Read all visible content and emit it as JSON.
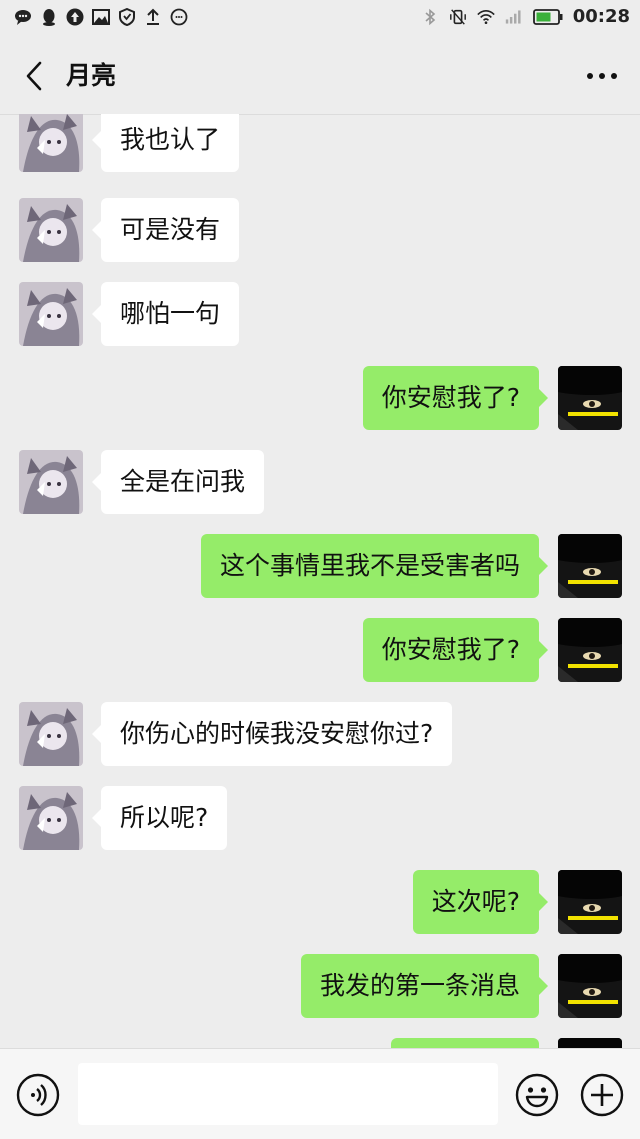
{
  "status_bar": {
    "time": "00:28",
    "left_icons": [
      "message-icon",
      "qq-icon",
      "upload-circle-icon",
      "image-icon",
      "shield-icon",
      "upload-icon",
      "smiley-icon"
    ],
    "right_icons": [
      "bluetooth-icon",
      "vibrate-icon",
      "wifi-icon",
      "signal-icon",
      "battery-icon"
    ]
  },
  "header": {
    "title": "月亮",
    "back_icon": "chevron-left-icon",
    "more_icon": "more-dots-icon"
  },
  "messages": [
    {
      "side": "left",
      "text": "我也认了"
    },
    {
      "side": "left",
      "text": "可是没有"
    },
    {
      "side": "left",
      "text": "哪怕一句"
    },
    {
      "side": "right",
      "text": "你安慰我了?"
    },
    {
      "side": "left",
      "text": "全是在问我"
    },
    {
      "side": "right",
      "text": "这个事情里我不是受害者吗"
    },
    {
      "side": "right",
      "text": "你安慰我了?"
    },
    {
      "side": "left",
      "text": "你伤心的时候我没安慰你过?"
    },
    {
      "side": "left",
      "text": "所以呢?"
    },
    {
      "side": "right",
      "text": "这次呢?"
    },
    {
      "side": "right",
      "text": "我发的第一条消息"
    },
    {
      "side": "right",
      "text": ""
    }
  ],
  "input_bar": {
    "voice_icon": "voice-icon",
    "text_value": "",
    "emoji_icon": "emoji-icon",
    "plus_icon": "plus-icon"
  },
  "colors": {
    "background": "#ededed",
    "incoming_bubble": "#ffffff",
    "outgoing_bubble": "#95ec69"
  }
}
